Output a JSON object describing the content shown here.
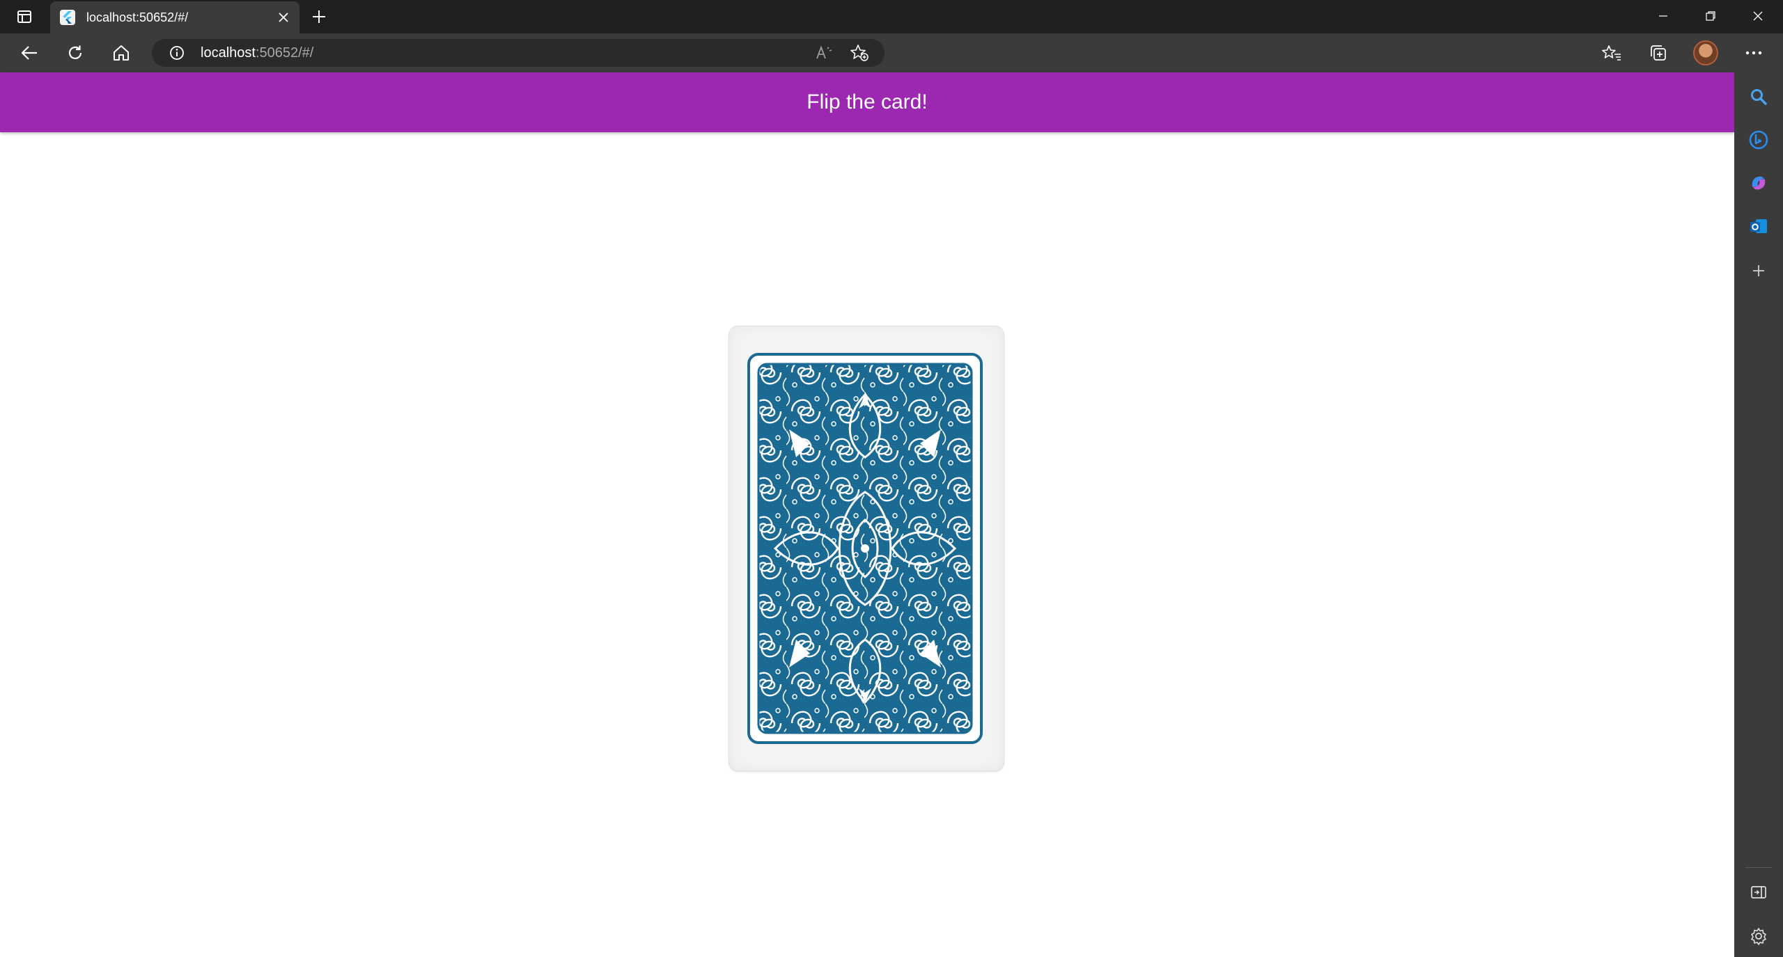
{
  "browser": {
    "tab": {
      "title": "localhost:50652/#/"
    },
    "address": {
      "host": "localhost",
      "rest": ":50652/#/"
    },
    "colors": {
      "chrome_dark": "#202020",
      "chrome": "#3b3b3b",
      "addressbar": "#2a2a2a"
    },
    "toolbar_icons": [
      "back-icon",
      "refresh-icon",
      "home-icon",
      "info-icon",
      "read-aloud-icon",
      "add-favorite-icon",
      "favorites-icon",
      "collections-icon",
      "profile-avatar",
      "more-icon"
    ],
    "sidebar_icons": [
      "search-icon",
      "bing-icon",
      "copilot-icon",
      "outlook-icon",
      "add-icon",
      "hide-sidebar-icon",
      "settings-icon"
    ]
  },
  "app": {
    "title": "Flip the card!",
    "accent_color": "#9c27b0",
    "card": {
      "face": "back",
      "pattern_color": "#1a6a93"
    }
  }
}
